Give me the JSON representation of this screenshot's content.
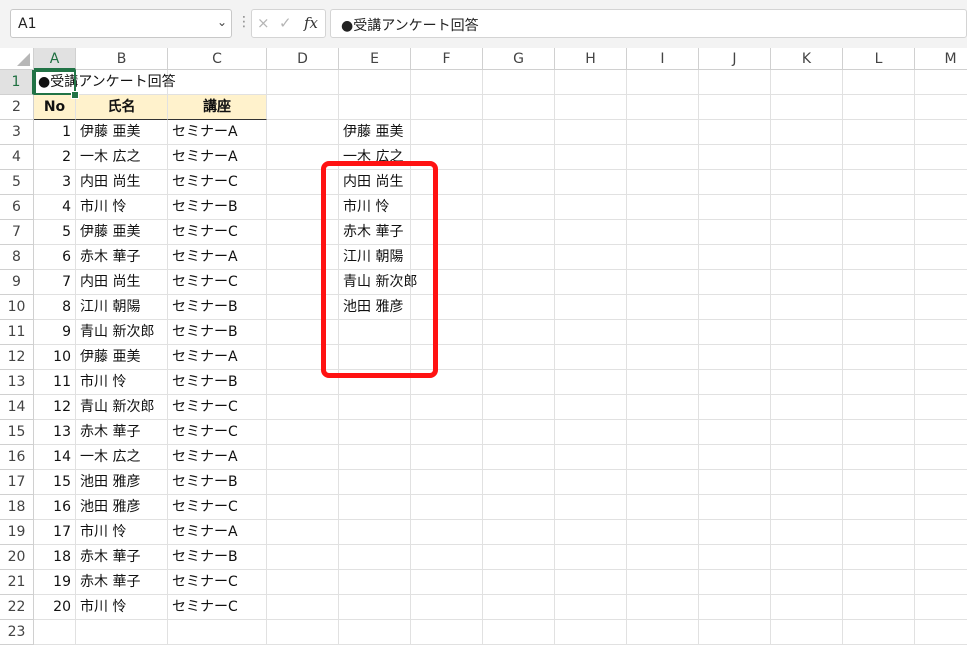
{
  "formula_bar": {
    "name_box": "A1",
    "separator": "⋮",
    "formula": "●受講アンケート回答",
    "cancel_icon": "×",
    "enter_icon": "✓",
    "fx_icon": "fx"
  },
  "columns": [
    "A",
    "B",
    "C",
    "D",
    "E",
    "F",
    "G",
    "H",
    "I",
    "J",
    "K",
    "L",
    "M"
  ],
  "rows": [
    "1",
    "2",
    "3",
    "4",
    "5",
    "6",
    "7",
    "8",
    "9",
    "10",
    "11",
    "12",
    "13",
    "14",
    "15",
    "16",
    "17",
    "18",
    "19",
    "20",
    "21",
    "22",
    "23"
  ],
  "sheet": {
    "title": "●受講アンケート回答",
    "headers": [
      "No",
      "氏名",
      "講座"
    ],
    "records": [
      {
        "no": "1",
        "name": "伊藤 亜美",
        "course": "セミナーA"
      },
      {
        "no": "2",
        "name": "一木 広之",
        "course": "セミナーA"
      },
      {
        "no": "3",
        "name": "内田 尚生",
        "course": "セミナーC"
      },
      {
        "no": "4",
        "name": "市川 怜",
        "course": "セミナーB"
      },
      {
        "no": "5",
        "name": "伊藤 亜美",
        "course": "セミナーC"
      },
      {
        "no": "6",
        "name": "赤木 華子",
        "course": "セミナーA"
      },
      {
        "no": "7",
        "name": "内田 尚生",
        "course": "セミナーC"
      },
      {
        "no": "8",
        "name": "江川 朝陽",
        "course": "セミナーB"
      },
      {
        "no": "9",
        "name": "青山 新次郎",
        "course": "セミナーB"
      },
      {
        "no": "10",
        "name": "伊藤 亜美",
        "course": "セミナーA"
      },
      {
        "no": "11",
        "name": "市川 怜",
        "course": "セミナーB"
      },
      {
        "no": "12",
        "name": "青山 新次郎",
        "course": "セミナーC"
      },
      {
        "no": "13",
        "name": "赤木 華子",
        "course": "セミナーC"
      },
      {
        "no": "14",
        "name": "一木 広之",
        "course": "セミナーA"
      },
      {
        "no": "15",
        "name": "池田 雅彦",
        "course": "セミナーB"
      },
      {
        "no": "16",
        "name": "池田 雅彦",
        "course": "セミナーC"
      },
      {
        "no": "17",
        "name": "市川 怜",
        "course": "セミナーA"
      },
      {
        "no": "18",
        "name": "赤木 華子",
        "course": "セミナーB"
      },
      {
        "no": "19",
        "name": "赤木 華子",
        "course": "セミナーC"
      },
      {
        "no": "20",
        "name": "市川 怜",
        "course": "セミナーC"
      }
    ],
    "unique_names": [
      "伊藤 亜美",
      "一木 広之",
      "内田 尚生",
      "市川 怜",
      "赤木 華子",
      "江川 朝陽",
      "青山 新次郎",
      "池田 雅彦"
    ]
  },
  "colors": {
    "accent": "#217346",
    "header_fill": "#fff2cc",
    "highlight": "#ff1212"
  }
}
